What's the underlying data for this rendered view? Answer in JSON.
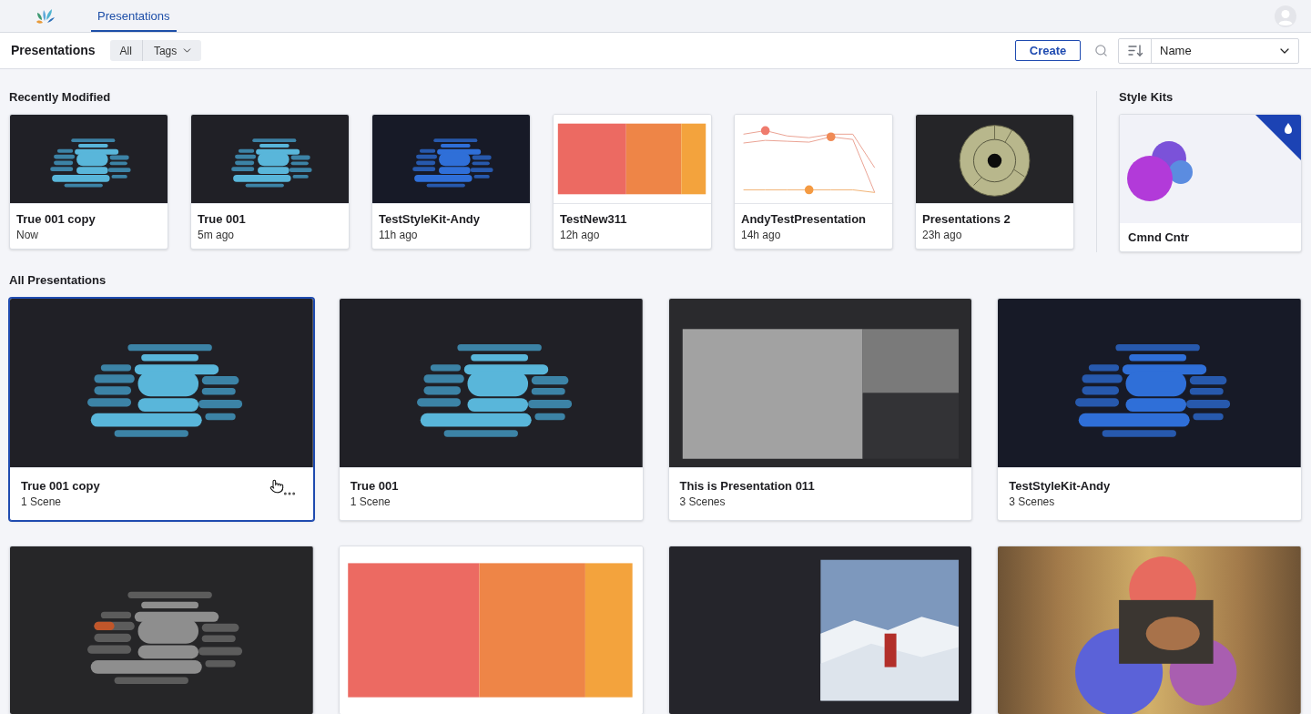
{
  "top_nav": {
    "tabs": [
      {
        "label": "Presentations",
        "selected": true
      }
    ]
  },
  "toolbar": {
    "title": "Presentations",
    "filters": [
      {
        "label": "All",
        "kind": "button"
      },
      {
        "label": "Tags",
        "kind": "dropdown"
      }
    ],
    "create_button": "Create",
    "sort": {
      "value": "Name"
    }
  },
  "recently_modified": {
    "heading": "Recently Modified",
    "items": [
      {
        "title": "True 001 copy",
        "subtitle": "Now",
        "kind": "wordcloud"
      },
      {
        "title": "True 001",
        "subtitle": "5m ago",
        "kind": "wordcloud"
      },
      {
        "title": "TestStyleKit-Andy",
        "subtitle": "11h ago",
        "kind": "bluecloud"
      },
      {
        "title": "TestNew311",
        "subtitle": "12h ago",
        "kind": "colortreemap"
      },
      {
        "title": "AndyTestPresentation",
        "subtitle": "14h ago",
        "kind": "linechart"
      },
      {
        "title": "Presentations 2",
        "subtitle": "23h ago",
        "kind": "sunburst"
      }
    ]
  },
  "style_kits": {
    "heading": "Style Kits",
    "items": [
      {
        "name": "Cmnd Cntr"
      }
    ]
  },
  "all_presentations": {
    "heading": "All Presentations",
    "items": [
      {
        "title": "True 001 copy",
        "subtitle": "1 Scene",
        "kind": "wordcloud",
        "selected": true
      },
      {
        "title": "True 001",
        "subtitle": "1 Scene",
        "kind": "wordcloud",
        "selected": false
      },
      {
        "title": "This is Presentation 011",
        "subtitle": "3 Scenes",
        "kind": "treemap",
        "selected": false
      },
      {
        "title": "TestStyleKit-Andy",
        "subtitle": "3 Scenes",
        "kind": "bluecloud",
        "selected": false
      },
      {
        "kind": "greycloud",
        "selected": false
      },
      {
        "kind": "colortreemap",
        "selected": false
      },
      {
        "kind": "photoslide",
        "selected": false
      },
      {
        "kind": "bubbles",
        "selected": false
      }
    ]
  }
}
